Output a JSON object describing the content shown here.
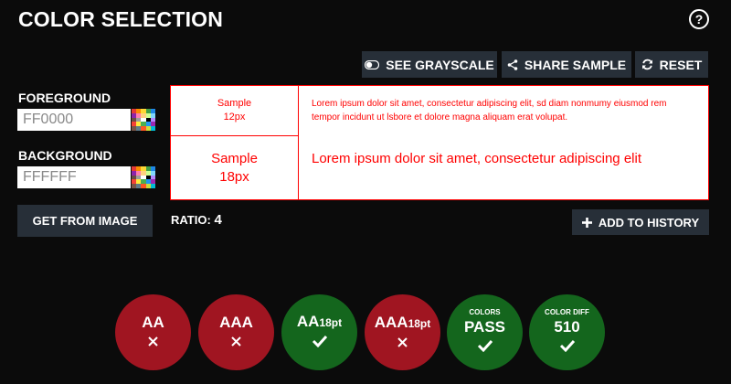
{
  "header": {
    "title": "COLOR SELECTION",
    "help_icon": "help-circle-icon",
    "help_label": "?"
  },
  "toolbar": {
    "grayscale_label": "SEE GRAYSCALE",
    "share_label": "SHARE SAMPLE",
    "reset_label": "RESET"
  },
  "foreground": {
    "label": "FOREGROUND",
    "value": "FF0000",
    "placeholder": ""
  },
  "background": {
    "label": "BACKGROUND",
    "value": "FFFFFF",
    "placeholder": ""
  },
  "get_from_image_label": "GET FROM IMAGE",
  "preview": {
    "small_sample_line1": "Sample",
    "small_sample_line2": "12px",
    "large_sample_line1": "Sample",
    "large_sample_line2": "18px",
    "small_text": "Lorem ipsum dolor sit amet, consectetur adipiscing elit, sd diam nonmumy eiusmod rem tempor incidunt ut lsbore et dolore magna aliquam erat volupat.",
    "large_text": "Lorem ipsum dolor sit amet, consectetur adipiscing elit",
    "text_color": "#FF0000",
    "bg_color": "#FFFFFF"
  },
  "ratio": {
    "label": "RATIO:",
    "value": "4"
  },
  "add_history_label": "ADD TO HISTORY",
  "results": [
    {
      "top": "",
      "label": "AA",
      "suffix": "",
      "status": "fail"
    },
    {
      "top": "",
      "label": "AAA",
      "suffix": "",
      "status": "fail"
    },
    {
      "top": "",
      "label": "AA",
      "suffix": "18pt",
      "status": "pass"
    },
    {
      "top": "",
      "label": "AAA",
      "suffix": "18pt",
      "status": "fail"
    },
    {
      "top": "COLORS",
      "label": "PASS",
      "suffix": "",
      "status": "pass"
    },
    {
      "top": "COLOR DIFF",
      "label": "510",
      "suffix": "",
      "status": "pass"
    }
  ],
  "palette_colors": [
    "#e53935",
    "#fb8c00",
    "#fdd835",
    "#43a047",
    "#1e88e5",
    "#8e24aa",
    "#ff80ab",
    "#ffd180",
    "#ccff90",
    "#80d8ff",
    "#6d4c41",
    "#9e9e9e",
    "#ffffff",
    "#000000",
    "#b388ff",
    "#f44336",
    "#ffeb3b",
    "#4caf50",
    "#2196f3",
    "#9c27b0",
    "#795548",
    "#607d8b",
    "#ff5722",
    "#cddc39",
    "#00bcd4"
  ],
  "colors": {
    "fail": "#a01521",
    "pass": "#14661d",
    "button": "#272f38",
    "page": "#0b0b0b"
  }
}
